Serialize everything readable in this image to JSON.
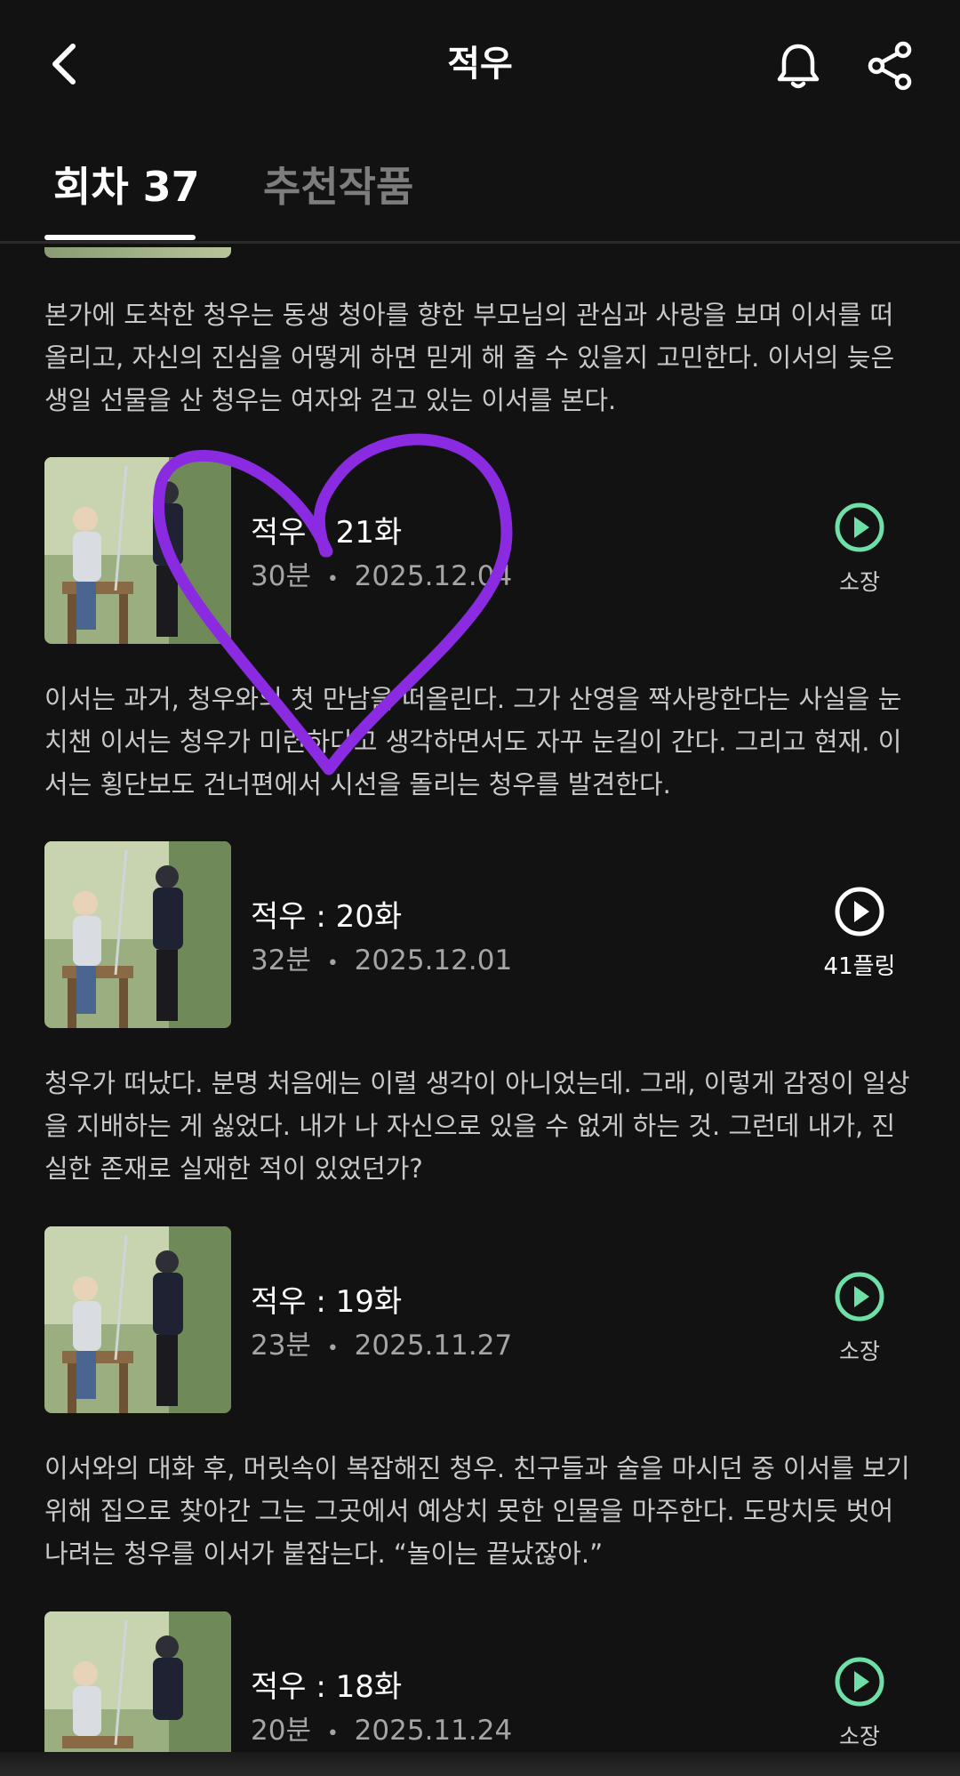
{
  "header": {
    "title": "적우",
    "back_icon": "chevron-left-icon",
    "bell_icon": "bell-icon",
    "share_icon": "share-icon"
  },
  "tabs": [
    {
      "label": "회차 37",
      "active": true
    },
    {
      "label": "추천작품",
      "active": false
    }
  ],
  "colors": {
    "background": "#121212",
    "owned_accent": "#6ee0a7",
    "heart_annotation": "#8a2be2"
  },
  "intro_description": "본가에 도착한 청우는 동생 청아를 향한 부모님의 관심과 사랑을 보며 이서를 떠올리고, 자신의 진심을 어떻게 하면 믿게 해 줄 수 있을지 고민한다. 이서의 늦은 생일 선물을 산 청우는 여자와 걷고 있는 이서를 본다.",
  "episodes": [
    {
      "title": "적우 : 21화",
      "duration": "30분",
      "date": "2025.12.04",
      "status_label": "소장",
      "status_icon": "play-circle-icon",
      "description": "이서는 과거, 청우와의 첫 만남을 떠올린다. 그가 산영을 짝사랑한다는 사실을 눈치챈 이서는 청우가 미련하다고 생각하면서도 자꾸 눈길이 간다. 그리고 현재. 이서는 횡단보도 건너편에서 시선을 돌리는 청우를 발견한다."
    },
    {
      "title": "적우 : 20화",
      "duration": "32분",
      "date": "2025.12.01",
      "status_label": "41플링",
      "status_icon": "play-circle-icon",
      "description": "청우가 떠났다. 분명 처음에는 이럴 생각이 아니었는데. 그래, 이렇게 감정이 일상을 지배하는 게 싫었다. 내가 나 자신으로 있을 수 없게 하는 것. 그런데 내가, 진실한 존재로 실재한 적이 있었던가?"
    },
    {
      "title": "적우 : 19화",
      "duration": "23분",
      "date": "2025.11.27",
      "status_label": "소장",
      "status_icon": "play-circle-icon",
      "description": "이서와의 대화 후, 머릿속이 복잡해진 청우. 친구들과 술을 마시던 중 이서를 보기 위해 집으로 찾아간 그는 그곳에서 예상치 못한 인물을 마주한다. 도망치듯 벗어나려는 청우를 이서가 붙잡는다. “놀이는 끝났잖아.”"
    },
    {
      "title": "적우 : 18화",
      "duration": "20분",
      "date": "2025.11.24",
      "status_label": "소장",
      "status_icon": "play-circle-icon"
    }
  ],
  "meta_separator": "•"
}
